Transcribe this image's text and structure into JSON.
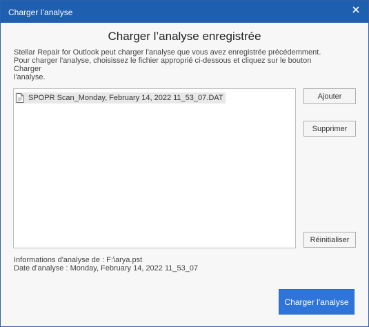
{
  "window": {
    "title": "Charger l’analyse",
    "close_icon": "close-icon"
  },
  "dialog": {
    "heading": "Charger l’analyse enregistrée",
    "description_line1": "Stellar Repair for Outlook peut charger l'analyse que vous avez enregistrée précédemment.",
    "description_line2": "Pour charger l'analyse, choisissez le fichier approprié ci-dessous et cliquez sur le bouton Charger",
    "description_line3": "l'analyse."
  },
  "file_list": {
    "items": [
      {
        "icon": "document-icon",
        "name": "SPOPR Scan_Monday, February 14, 2022 11_53_07.DAT",
        "selected": true
      }
    ]
  },
  "buttons": {
    "add": "Ajouter",
    "remove": "Supprimer",
    "reset": "Réinitialiser",
    "load": "Charger l'analyse"
  },
  "info": {
    "source": "Informations d'analyse de : F:\\arya.pst",
    "date": "Date d'analyse : Monday, February 14, 2022 11_53_07"
  },
  "colors": {
    "titlebar": "#1f5fb0",
    "primary_button": "#2f74d9",
    "background": "#f7f7f7"
  }
}
